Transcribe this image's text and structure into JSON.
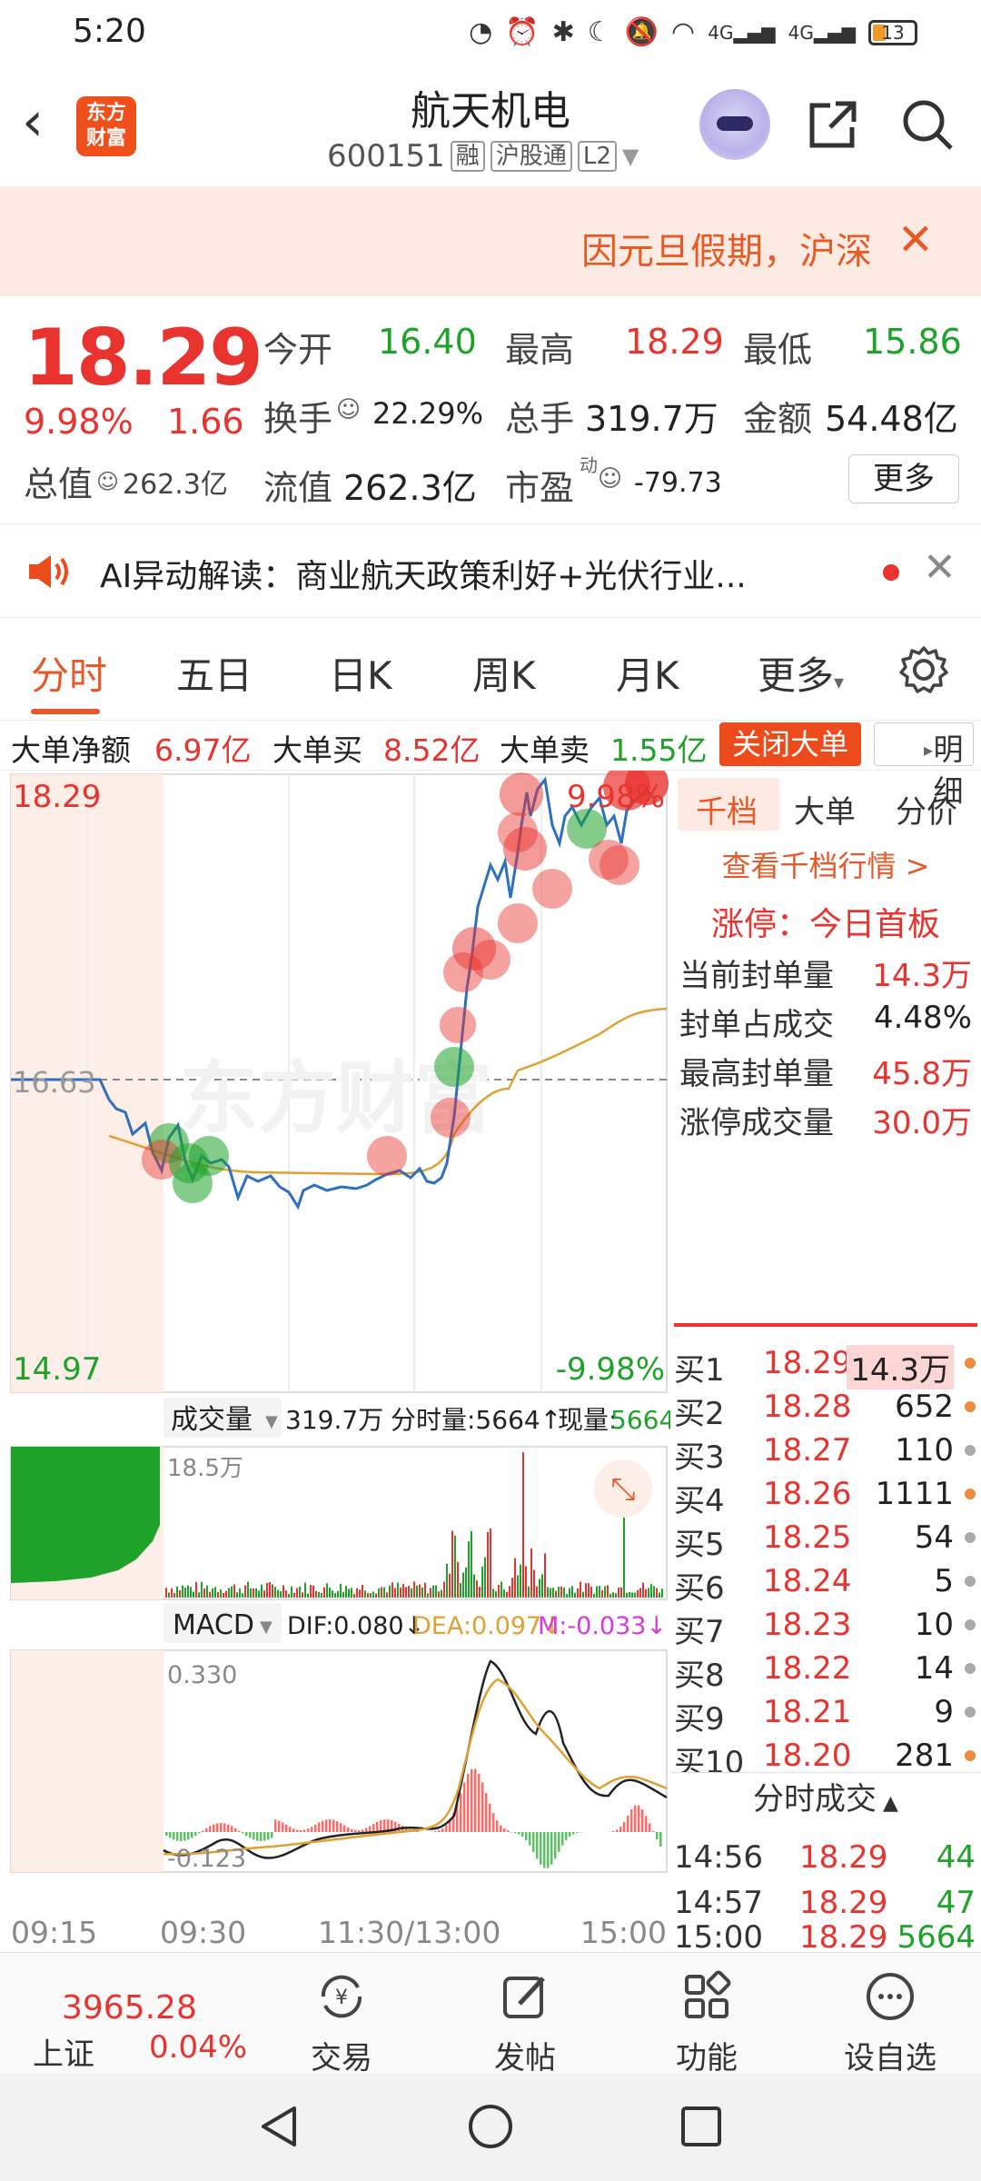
{
  "status_bar": {
    "time": "5:20",
    "battery": "13",
    "signal_1": "4G",
    "signal_2": "4G"
  },
  "header": {
    "logo_line1": "东方",
    "logo_line2": "财富",
    "title": "航天机电",
    "code": "600151",
    "tag_rong": "融",
    "tag_hgt": "沪股通",
    "tag_l2": "L2"
  },
  "notice": {
    "text": "因元旦假期，沪深"
  },
  "quote": {
    "price": "18.29",
    "pct": "9.98%",
    "change": "1.66",
    "open_label": "今开",
    "open_value": "16.40",
    "high_label": "最高",
    "high_value": "18.29",
    "low_label": "最低",
    "low_value": "15.86",
    "turnover_label": "换手",
    "turnover_value": "22.29%",
    "volume_label": "总手",
    "volume_value": "319.7万",
    "amount_label": "金额",
    "amount_value": "54.48亿",
    "mcap_label": "总值",
    "mcap_value": "262.3亿",
    "float_label": "流值",
    "float_value": "262.3亿",
    "pe_label": "市盈",
    "pe_sup": "动",
    "pe_value": "-79.73",
    "more_label": "更多"
  },
  "ai": {
    "text": "AI异动解读：商业航天政策利好+光伏行业..."
  },
  "tabs": [
    {
      "label": "分时"
    },
    {
      "label": "五日"
    },
    {
      "label": "日K"
    },
    {
      "label": "周K"
    },
    {
      "label": "月K"
    },
    {
      "label": "更多"
    }
  ],
  "big_order": {
    "net_label": "大单净额",
    "net_value": "6.97亿",
    "buy_label": "大单买",
    "buy_value": "8.52亿",
    "sell_label": "大单卖",
    "sell_value": "1.55亿",
    "close_label": "关闭大单",
    "detail_label": "明细"
  },
  "chart": {
    "y_top": "18.29",
    "y_mid": "16.63",
    "y_bottom": "14.97",
    "pct_top": "9.98%",
    "pct_bottom": "-9.98%",
    "watermark": "东方财富",
    "vol_selector": "成交量",
    "vol_total": "319.7万",
    "vol_last_label": "分时量:5664↑",
    "vol_now_label": "现量:",
    "vol_now_value": "5664",
    "vol_max": "18.5万",
    "macd_selector": "MACD",
    "dif": "DIF:0.080↓",
    "dea": "DEA:0.097↓",
    "m": "M:-0.033↓",
    "macd_top": "0.330",
    "macd_bottom": "-0.123",
    "time_labels": [
      "09:15",
      "09:30",
      "11:30/13:00",
      "15:00"
    ],
    "colors": {
      "up": "#e8332f",
      "down": "#1fa22a",
      "price_line": "#2f6fc0",
      "avg_line": "#e0a133",
      "macd_m": "#d63bd6"
    }
  },
  "panel": {
    "tabs": [
      "千档",
      "大单",
      "分价"
    ],
    "link": "查看千档行情 >",
    "limit_title": "涨停：今日首板",
    "stats": [
      {
        "label": "当前封单量",
        "value": "14.3万"
      },
      {
        "label": "封单占成交",
        "value": "4.48%"
      },
      {
        "label": "最高封单量",
        "value": "45.8万"
      },
      {
        "label": "涨停成交量",
        "value": "30.0万"
      }
    ],
    "orderbook": [
      {
        "k": "买1",
        "p": "18.29",
        "v": "14.3万"
      },
      {
        "k": "买2",
        "p": "18.28",
        "v": "652"
      },
      {
        "k": "买3",
        "p": "18.27",
        "v": "110"
      },
      {
        "k": "买4",
        "p": "18.26",
        "v": "1111"
      },
      {
        "k": "买5",
        "p": "18.25",
        "v": "54"
      },
      {
        "k": "买6",
        "p": "18.24",
        "v": "5"
      },
      {
        "k": "买7",
        "p": "18.23",
        "v": "10"
      },
      {
        "k": "买8",
        "p": "18.22",
        "v": "14"
      },
      {
        "k": "买9",
        "p": "18.21",
        "v": "9"
      },
      {
        "k": "买10",
        "p": "18.20",
        "v": "281"
      }
    ],
    "trades_header": "分时成交",
    "trades": [
      {
        "t": "14:56",
        "p": "18.29",
        "v": "44"
      },
      {
        "t": "14:57",
        "p": "18.29",
        "v": "47"
      },
      {
        "t": "15:00",
        "p": "18.29",
        "v": "5664"
      }
    ]
  },
  "bottom": {
    "index_value": "3965.28",
    "index_name": "上证",
    "index_pct": "0.04%",
    "nav": [
      {
        "label": "交易"
      },
      {
        "label": "发帖"
      },
      {
        "label": "功能"
      },
      {
        "label": "设自选"
      }
    ]
  }
}
